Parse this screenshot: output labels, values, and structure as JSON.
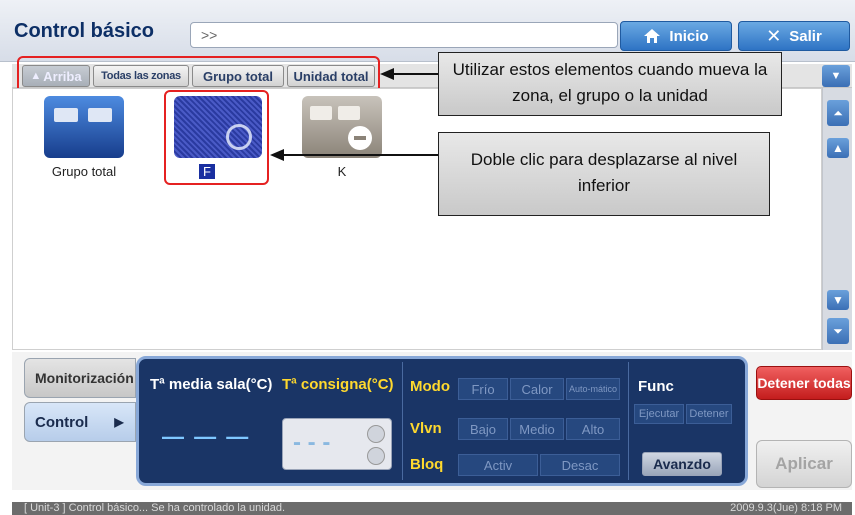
{
  "title": "Control básico",
  "path": ">>",
  "top_buttons": {
    "home": "Inicio",
    "exit": "Salir"
  },
  "nav": {
    "up": "Arriba",
    "all_zones": "Todas las zonas",
    "all_groups": "Grupo total",
    "all_units": "Unidad total"
  },
  "items": [
    {
      "label": "Grupo total"
    },
    {
      "label": "F"
    },
    {
      "label": "K"
    }
  ],
  "callouts": {
    "nav_hint": "Utilizar estos elementos cuando mueva la zona, el grupo o la unidad",
    "double_click_hint": "Doble clic para desplazarse al nivel inferior"
  },
  "tabs": {
    "monitor": "Monitorización",
    "control": "Control"
  },
  "panel": {
    "room_temp_label": "Tª media sala(°C)",
    "setpoint_label": "Tª consigna(°C)",
    "room_temp_value": "— — —",
    "setpoint_value": "- - -",
    "mode_label": "Modo",
    "mode_options": [
      "Frío",
      "Calor",
      "Auto-mático"
    ],
    "fan_label": "Vlvn",
    "fan_options": [
      "Bajo",
      "Medio",
      "Alto"
    ],
    "lock_label": "Bloq",
    "lock_options": [
      "Activ",
      "Desac"
    ],
    "func_label": "Func",
    "func_options": [
      "Ejecutar",
      "Detener"
    ],
    "advanced": "Avanzdo"
  },
  "stop_all": "Detener todas",
  "apply": "Aplicar",
  "status": {
    "message": "[ Unit-3 ] Control básico... Se ha controlado la unidad.",
    "datetime": "2009.9.3(Jue)  8:18 PM"
  },
  "colors": {
    "accent": "#2e73c4",
    "panel": "#1a3566",
    "highlight": "#e52121"
  }
}
